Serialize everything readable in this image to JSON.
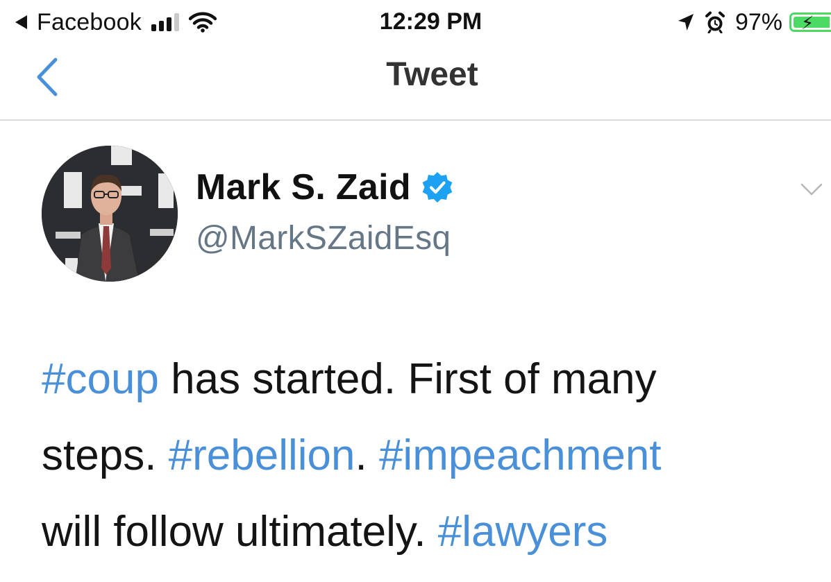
{
  "status_bar": {
    "back_app": "Facebook",
    "time": "12:29 PM",
    "battery_percent": "97%",
    "battery_level": 0.97,
    "signal_bars": 3,
    "signal_total": 4
  },
  "nav": {
    "title": "Tweet"
  },
  "tweet": {
    "author_name": "Mark S. Zaid",
    "handle": "@MarkSZaidEsq",
    "verified": true,
    "lines": [
      [
        {
          "text": "#coup",
          "tag": true
        },
        {
          "text": " has started. First of many",
          "tag": false
        }
      ],
      [
        {
          "text": "steps. ",
          "tag": false
        },
        {
          "text": "#rebellion",
          "tag": true
        },
        {
          "text": ". ",
          "tag": false
        },
        {
          "text": "#impeachment",
          "tag": true
        }
      ],
      [
        {
          "text": "will follow ultimately. ",
          "tag": false
        },
        {
          "text": "#lawyers",
          "tag": true
        }
      ]
    ]
  },
  "colors": {
    "link_blue": "#4a90d9",
    "verified_blue": "#1da1f2",
    "handle_gray": "#657786",
    "battery_green": "#4cd964",
    "divider": "#dcdcdc"
  },
  "icons": {
    "status_back": "back-triangle-icon",
    "signal": "signal-bars-icon",
    "wifi": "wifi-icon",
    "location": "location-arrow-icon",
    "alarm": "alarm-clock-icon",
    "battery": "battery-charging-icon",
    "nav_back": "chevron-left-icon",
    "verified": "verified-badge-icon",
    "more": "chevron-down-icon"
  }
}
